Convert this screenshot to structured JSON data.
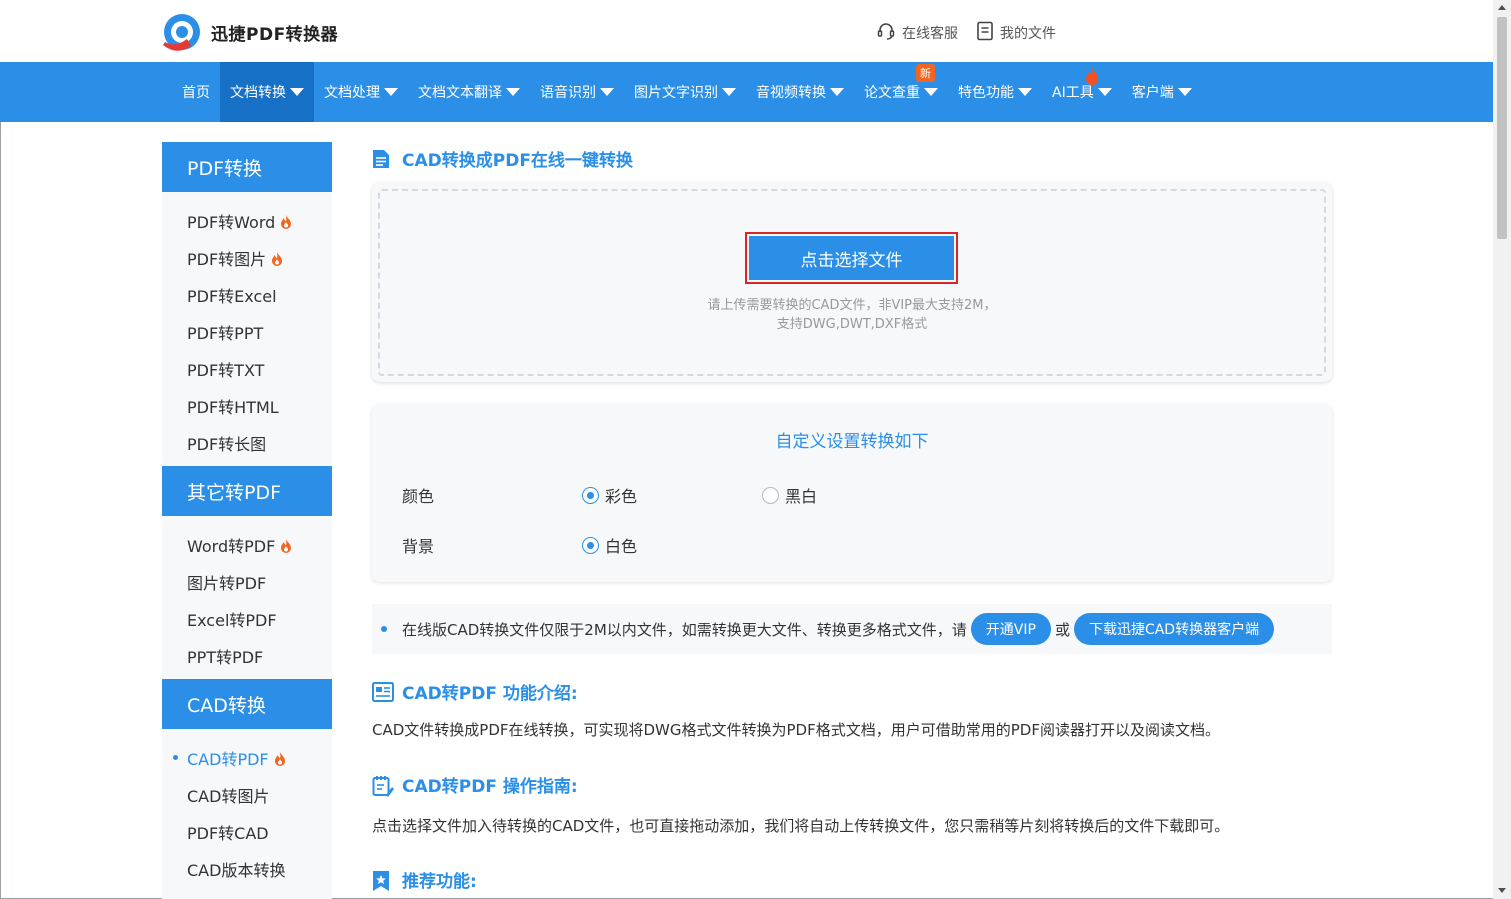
{
  "header": {
    "brand": "迅捷PDF转换器",
    "links": [
      {
        "label": "在线客服",
        "icon": "headset-icon"
      },
      {
        "label": "我的文件",
        "icon": "file-icon"
      }
    ]
  },
  "nav": {
    "items": [
      {
        "label": "首页"
      },
      {
        "label": "文档转换"
      },
      {
        "label": "文档处理"
      },
      {
        "label": "文档文本翻译"
      },
      {
        "label": "语音识别"
      },
      {
        "label": "图片文字识别"
      },
      {
        "label": "音视频转换"
      },
      {
        "label": "论文查重",
        "badge": "新"
      },
      {
        "label": "特色功能"
      },
      {
        "label": "AI工具"
      },
      {
        "label": "客户端"
      }
    ]
  },
  "sidebar": {
    "groups": [
      {
        "title": "PDF转换",
        "items": [
          "PDF转Word",
          "PDF转图片",
          "PDF转Excel",
          "PDF转PPT",
          "PDF转TXT",
          "PDF转HTML",
          "PDF转长图"
        ]
      },
      {
        "title": "其它转PDF",
        "items": [
          "Word转PDF",
          "图片转PDF",
          "Excel转PDF",
          "PPT转PDF"
        ]
      },
      {
        "title": "CAD转换",
        "items": [
          "CAD转PDF",
          "CAD转图片",
          "PDF转CAD",
          "CAD版本转换"
        ]
      }
    ]
  },
  "main": {
    "title": "CAD转换成PDF在线一键转换",
    "upload": {
      "button": "点击选择文件",
      "hint_line1": "请上传需要转换的CAD文件，非VIP最大支持2M，",
      "hint_line2": "支持DWG,DWT,DXF格式"
    },
    "settings": {
      "title": "自定义设置转换如下",
      "color_label": "颜色",
      "color_opt1": "彩色",
      "color_opt2": "黑白",
      "bg_label": "背景",
      "bg_opt1": "白色"
    },
    "notice": {
      "text": "在线版CAD转换文件仅限于2M以内文件，如需转换更大文件、转换更多格式文件，请",
      "vip_button": "开通VIP",
      "or": "或",
      "download_button": "下载迅捷CAD转换器客户端"
    },
    "intro": {
      "title": "CAD转PDF 功能介绍:",
      "text": "CAD文件转换成PDF在线转换，可实现将DWG格式文件转换为PDF格式文档，用户可借助常用的PDF阅读器打开以及阅读文档。"
    },
    "guide": {
      "title": "CAD转PDF 操作指南:",
      "text": "点击选择文件加入待转换的CAD文件，也可直接拖动添加，我们将自动上传转换文件，您只需稍等片刻将转换后的文件下载即可。"
    },
    "recommend": {
      "title": "推荐功能:"
    }
  },
  "colors": {
    "primary": "#2b8fe8",
    "nav_active": "#1570c6",
    "hot": "#f26522",
    "highlight_border": "#d9252a"
  }
}
